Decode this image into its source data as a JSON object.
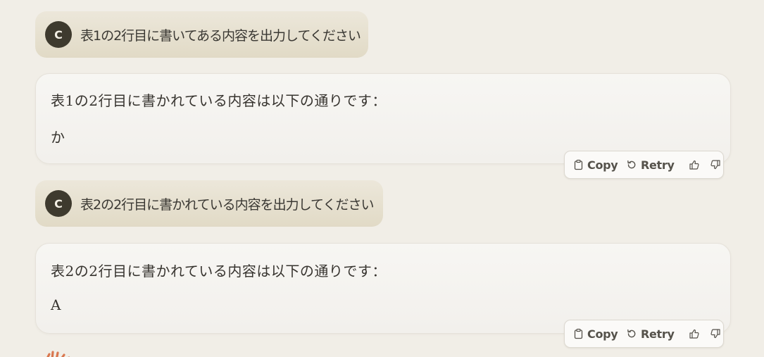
{
  "conversation": {
    "user_avatar_letter": "C",
    "messages": [
      {
        "user_text": "表1の2行目に書いてある内容を出力してください",
        "ai_line1": "表1の2行目に書かれている内容は以下の通りです：",
        "ai_line2": "か"
      },
      {
        "user_text": "表2の2行目に書かれている内容を出力してください",
        "ai_line1": "表2の2行目に書かれている内容は以下の通りです：",
        "ai_line2": "A"
      }
    ]
  },
  "actions": {
    "copy_label": "Copy",
    "retry_label": "Retry",
    "icons": [
      "clipboard-icon",
      "retry-icon",
      "thumbs-up-icon",
      "thumbs-down-icon"
    ]
  },
  "colors": {
    "background": "#f1eee7",
    "user_bubble": "#e6e0cf",
    "avatar": "#3e3a2e",
    "logo_accent": "#d9774f"
  }
}
